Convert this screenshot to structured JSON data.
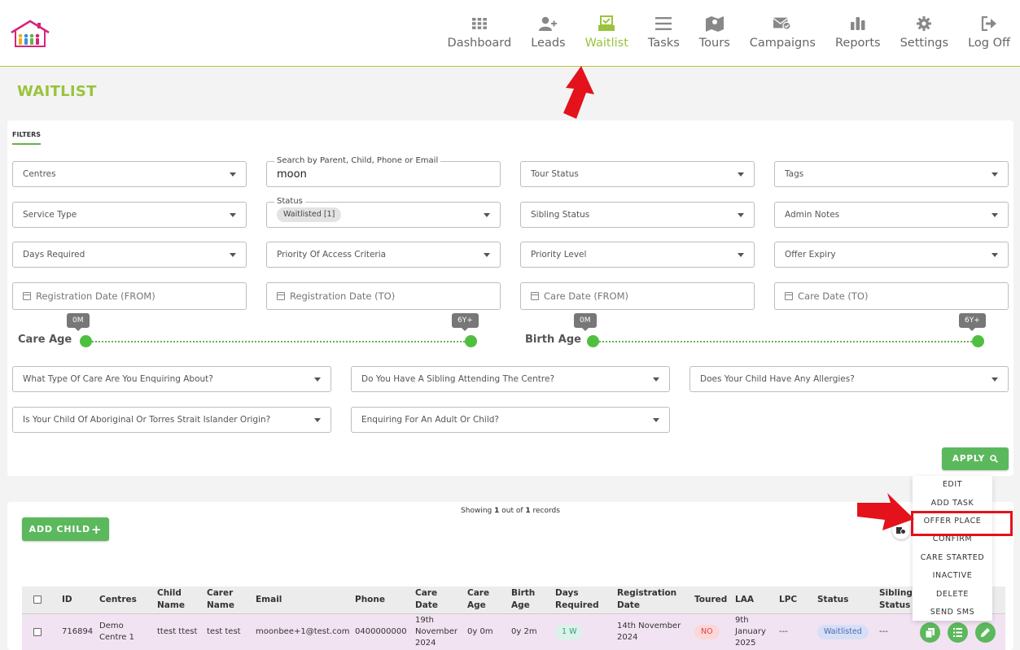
{
  "nav": {
    "items": [
      {
        "label": "Dashboard",
        "icon": "grid-icon"
      },
      {
        "label": "Leads",
        "icon": "user-plus-icon"
      },
      {
        "label": "Waitlist",
        "icon": "inbox-check-icon",
        "active": true
      },
      {
        "label": "Tasks",
        "icon": "list-icon"
      },
      {
        "label": "Tours",
        "icon": "map-icon"
      },
      {
        "label": "Campaigns",
        "icon": "mail-check-icon"
      },
      {
        "label": "Reports",
        "icon": "bar-chart-icon"
      },
      {
        "label": "Settings",
        "icon": "gear-icon"
      },
      {
        "label": "Log Off",
        "icon": "sign-out-icon"
      }
    ]
  },
  "page": {
    "title": "WAITLIST"
  },
  "filters": {
    "tab_label": "FILTERS",
    "centres": "Centres",
    "search_legend": "Search by Parent, Child, Phone or Email",
    "search_value": "moon",
    "tour_status": "Tour Status",
    "tags": "Tags",
    "service_type": "Service Type",
    "status_legend": "Status",
    "status_chip": "Waitlisted [1]",
    "sibling_status": "Sibling Status",
    "admin_notes": "Admin Notes",
    "days_required": "Days Required",
    "priority_access": "Priority Of Access Criteria",
    "priority_level": "Priority Level",
    "offer_expiry": "Offer Expiry",
    "reg_from": "Registration Date (FROM)",
    "reg_to": "Registration Date (TO)",
    "care_from": "Care Date (FROM)",
    "care_to": "Care Date (TO)",
    "care_age_label": "Care Age",
    "care_age_min": "0M",
    "care_age_max": "6Y+",
    "birth_age_label": "Birth Age",
    "birth_age_min": "0M",
    "birth_age_max": "6Y+",
    "q_care_type": "What Type Of Care Are You Enquiring About?",
    "q_sibling": "Do You Have A Sibling Attending The Centre?",
    "q_allergies": "Does Your Child Have Any Allergies?",
    "q_aboriginal": "Is Your Child Of Aboriginal Or Torres Strait Islander Origin?",
    "q_adult_child": "Enquiring For An Adult Or Child?",
    "apply_label": "APPLY"
  },
  "records": {
    "add_child_label": "ADD CHILD",
    "add_child_plus": "+",
    "showing_prefix": "Showing ",
    "showing_count": "1",
    "showing_mid": " out of ",
    "showing_total": "1",
    "showing_suffix": " records",
    "columns": [
      "ID",
      "Centres",
      "Child Name",
      "Carer Name",
      "Email",
      "Phone",
      "Care Date",
      "Care Age",
      "Birth Age",
      "Days Required",
      "Registration Date",
      "Toured",
      "LAA",
      "LPC",
      "Status",
      "Sibling Status"
    ],
    "rows": [
      {
        "id": "716894",
        "centre": "Demo Centre 1",
        "child_name": "ttest ttest",
        "carer_name": "test test",
        "email": "moonbee+1@test.com",
        "phone": "0400000000",
        "care_date": "19th November 2024",
        "care_age": "0y 0m",
        "birth_age": "0y 2m",
        "days_required": "1 W",
        "registration_date": "14th November 2024",
        "toured": "NO",
        "laa": "9th January 2025",
        "lpc": "---",
        "status": "Waitlisted",
        "sibling_status": "---"
      }
    ]
  },
  "action_menu": {
    "items": [
      "EDIT",
      "ADD TASK",
      "OFFER PLACE",
      "CONFIRM",
      "CARE STARTED",
      "INACTIVE",
      "DELETE",
      "SEND SMS"
    ]
  },
  "colors": {
    "accent": "#9ac33d",
    "button_green": "#5cb85c",
    "annotation_red": "#e3121b",
    "row_highlight": "#f2e3f2"
  }
}
